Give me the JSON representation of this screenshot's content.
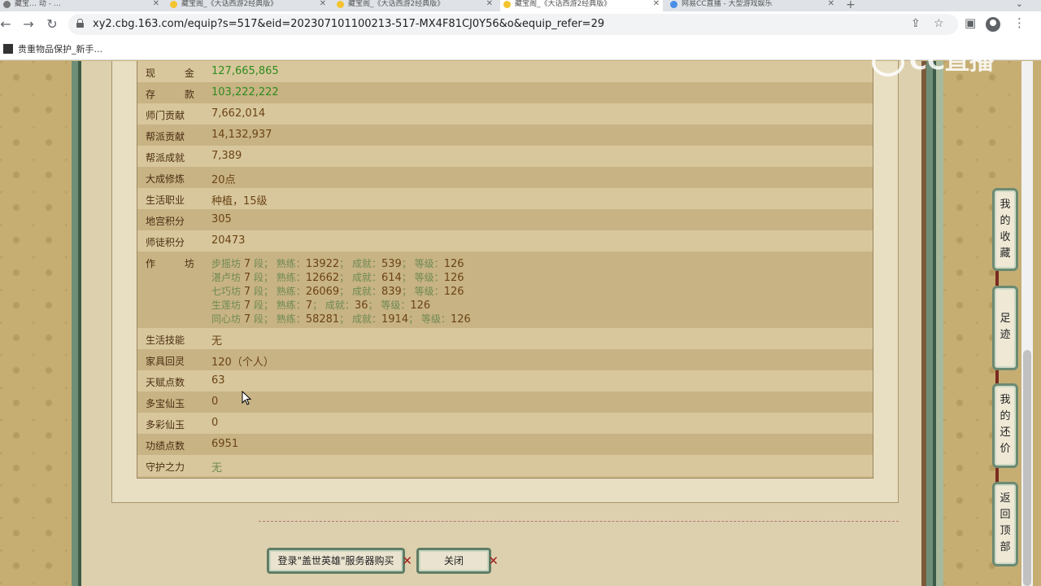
{
  "browser": {
    "tabs": [
      {
        "label": "藏宝… 动 - …",
        "active": false
      },
      {
        "label": "藏宝阁_《大话西游2经典版》",
        "active": false
      },
      {
        "label": "藏宝阁_《大话西游2经典版》",
        "active": false
      },
      {
        "label": "藏宝阁_《大话西游2经典版》",
        "active": true
      },
      {
        "label": "网易CC直播 - 大型游戏娱乐",
        "active": false
      }
    ],
    "url": "xy2.cbg.163.com/equip?s=517&eid=202307101100213-517-MX4F81CJ0Y56&o&equip_refer=29",
    "bookmark": "贵重物品保护_新手..."
  },
  "watermark": "CC直播",
  "info_rows": [
    {
      "label": "现  金",
      "value": "127,665,865",
      "style": "green",
      "spaced": true
    },
    {
      "label": "存  款",
      "value": "103,222,222",
      "style": "green",
      "spaced": true
    },
    {
      "label": "师门贡献",
      "value": "7,662,014",
      "style": "normal"
    },
    {
      "label": "帮派贡献",
      "value": "14,132,937",
      "style": "normal"
    },
    {
      "label": "帮派成就",
      "value": "7,389",
      "style": "normal"
    },
    {
      "label": "大成修炼",
      "value": "20点",
      "style": "normal"
    },
    {
      "label": "生活职业",
      "value": "种植，15级",
      "style": "normal"
    },
    {
      "label": "地宫积分",
      "value": "305",
      "style": "normal"
    },
    {
      "label": "师徒积分",
      "value": "20473",
      "style": "normal"
    }
  ],
  "workshop": {
    "label": "作  坊",
    "lines": [
      {
        "name": "步摇坊",
        "duan": "7",
        "shulian": "13922",
        "chengjiu": "539",
        "dengji": "126"
      },
      {
        "name": "湛卢坊",
        "duan": "7",
        "shulian": "12662",
        "chengjiu": "614",
        "dengji": "126"
      },
      {
        "name": "七巧坊",
        "duan": "7",
        "shulian": "26069",
        "chengjiu": "839",
        "dengji": "126"
      },
      {
        "name": "生莲坊",
        "duan": "7",
        "shulian": "7",
        "chengjiu": "36",
        "dengji": "126"
      },
      {
        "name": "同心坊",
        "duan": "7",
        "shulian": "58281",
        "chengjiu": "1914",
        "dengji": "126"
      }
    ],
    "text_duan": "段",
    "text_shulian": "熟练：",
    "text_chengjiu": "成就：",
    "text_dengji": "等级："
  },
  "info_rows_2": [
    {
      "label": "生活技能",
      "value": "无",
      "style": "normal"
    },
    {
      "label": "家具回灵",
      "value": "120（个人）",
      "style": "normal"
    },
    {
      "label": "天赋点数",
      "value": "63",
      "style": "normal"
    },
    {
      "label": "多宝仙玉",
      "value": "0",
      "style": "normal"
    },
    {
      "label": "多彩仙玉",
      "value": "0",
      "style": "normal"
    },
    {
      "label": "功绩点数",
      "value": "6951",
      "style": "normal"
    },
    {
      "label": "守护之力",
      "value": "无",
      "style": "muted"
    }
  ],
  "buttons": {
    "login_buy": "登录\"盖世英雄\"服务器购买",
    "close": "关闭"
  },
  "side_nav": [
    {
      "label": "我的收藏"
    },
    {
      "label": "足迹"
    },
    {
      "label": "我的还价"
    },
    {
      "label": "返回顶部"
    }
  ]
}
